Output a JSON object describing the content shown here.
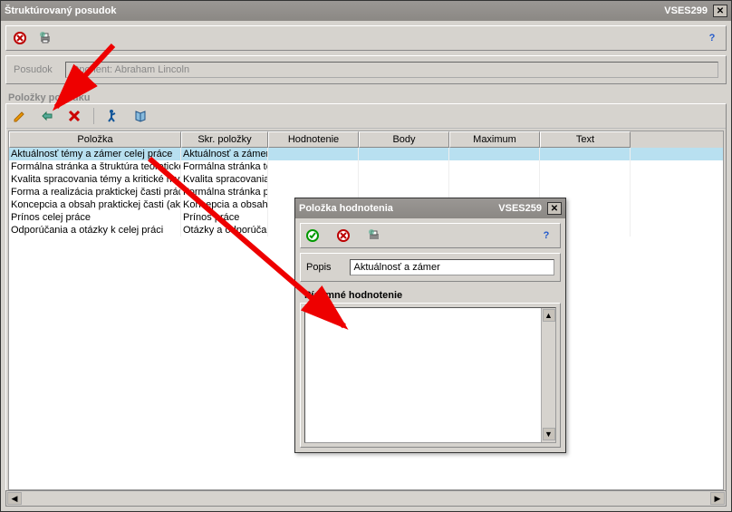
{
  "window": {
    "title": "Štruktúrovaný posudok",
    "code": "VSES299"
  },
  "posudok": {
    "label": "Posudok",
    "value": "Oponent: Abraham Lincoln"
  },
  "section_items_label": "Položky posudku",
  "grid": {
    "headers": [
      "Položka",
      "Skr. položky",
      "Hodnotenie",
      "Body",
      "Maximum",
      "Text"
    ],
    "rows": [
      {
        "polozka": "Aktuálnosť témy a zámer celej práce",
        "skratka": "Aktuálnosť a zámer",
        "selected": true
      },
      {
        "polozka": "Formálna stránka a štruktúra teoretickej",
        "skratka": "Formálna stránka te"
      },
      {
        "polozka": "Kvalita spracovania témy a kritické mys",
        "skratka": "Kvalita spracovania"
      },
      {
        "polozka": "Forma a realizácia praktickej časti prác",
        "skratka": "Formálna stránka pr"
      },
      {
        "polozka": "Koncepcia a obsah praktickej časti (akt",
        "skratka": "Koncepcia a obsah"
      },
      {
        "polozka": "Prínos celej práce",
        "skratka": "Prínos práce"
      },
      {
        "polozka": "Odporúčania a otázky k celej práci",
        "skratka": "Otázky a odporúčan"
      }
    ]
  },
  "modal": {
    "title": "Položka hodnotenia",
    "code": "VSES259",
    "popis_label": "Popis",
    "popis_value": "Aktuálnosť a zámer",
    "section_label": "Písomné hodnotenie"
  }
}
